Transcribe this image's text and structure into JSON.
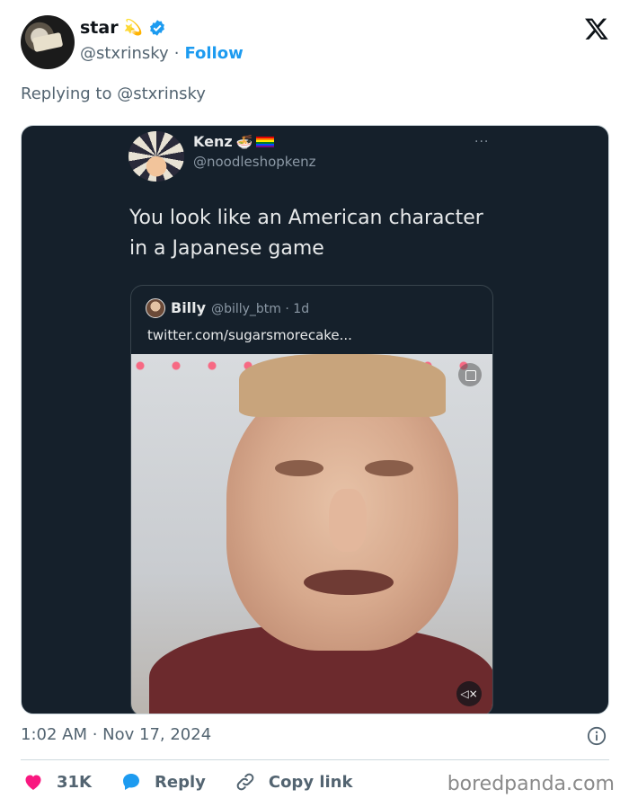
{
  "post": {
    "author_name": "star",
    "author_emoji": "💫",
    "author_handle": "@stxrinsky",
    "separator": "·",
    "follow_label": "Follow",
    "replying_prefix": "Replying to",
    "replying_handle": "@stxrinsky",
    "timestamp": "1:02 AM · Nov 17, 2024"
  },
  "embedded": {
    "name": "Kenz",
    "name_emoji": "🍜",
    "handle": "@noodleshopkenz",
    "more": "···",
    "text": "You look like an American character in a Japanese game",
    "quote": {
      "name": "Billy",
      "handle": "@billy_btm · 1d",
      "link": "twitter.com/sugarsmorecake..."
    },
    "mute_glyph": "◁×"
  },
  "actions": {
    "likes": "31K",
    "reply": "Reply",
    "copy": "Copy link"
  },
  "watermark": "boredpanda.com",
  "colors": {
    "accent": "#1d9bf0",
    "heart": "#f91880",
    "muted": "#536471",
    "dark_bg": "#15202b"
  },
  "icons": [
    "verified-badge-icon",
    "x-logo-icon",
    "more-dots-icon",
    "mute-icon",
    "info-icon",
    "heart-icon",
    "reply-bubble-icon",
    "link-icon"
  ]
}
